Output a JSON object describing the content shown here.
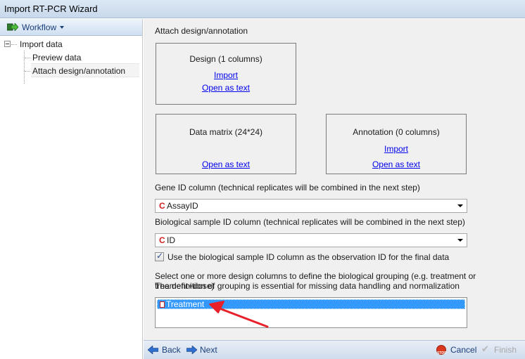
{
  "window": {
    "title": "Import RT-PCR Wizard"
  },
  "sidebar": {
    "header_label": "Workflow",
    "tree": {
      "root_label": "Import data",
      "children": [
        {
          "label": "Preview data"
        },
        {
          "label": "Attach design/annotation"
        }
      ]
    }
  },
  "main": {
    "section_title": "Attach design/annotation",
    "design_card": {
      "title": "Design (1 columns)",
      "import_link": "Import",
      "open_link": "Open as text"
    },
    "data_matrix_card": {
      "title": "Data matrix (24*24)",
      "open_link": "Open as text"
    },
    "annotation_card": {
      "title": "Annotation (0 columns)",
      "import_link": "Import",
      "open_link": "Open as text"
    },
    "gene_id": {
      "label": "Gene ID column (technical replicates will be combined in the next step)",
      "value": "AssayID",
      "type_glyph": "C"
    },
    "bio_sample_id": {
      "label": "Biological sample ID column (technical replicates will be combined in the next step)",
      "value": "ID",
      "type_glyph": "C"
    },
    "observation_checkbox": {
      "checked": true,
      "label": "Use the biological sample ID column as the observation ID for the final data"
    },
    "grouping": {
      "description_line1": "Select one or more design columns to define the biological grouping (e.g. treatment or treament+dose)",
      "description_line2": "The definition of grouping is essential for missing data handling and normalization",
      "items": [
        {
          "label": "Treatment",
          "selected": true
        }
      ]
    },
    "annotation_arrow_color": "#e8202a"
  },
  "footer": {
    "back_label": "Back",
    "next_label": "Next",
    "cancel_label": "Cancel",
    "finish_label": "Finish",
    "stop_glyph": "STOP"
  }
}
